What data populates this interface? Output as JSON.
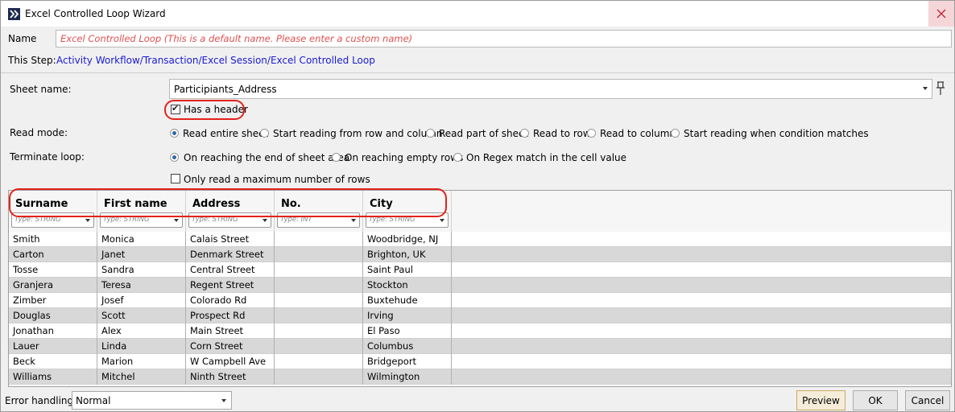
{
  "window": {
    "title": "Excel Controlled Loop Wizard"
  },
  "name_field": {
    "label": "Name",
    "placeholder": "Excel Controlled Loop  (This is a default name. Please enter a custom name)"
  },
  "step": {
    "label": "This Step:",
    "path": "Activity Workflow/Transaction/Excel Session/Excel Controlled Loop"
  },
  "sheet": {
    "label": "Sheet name:",
    "value": "Participiants_Address"
  },
  "has_header": {
    "label": "Has a header",
    "checked": true
  },
  "read_mode": {
    "label": "Read mode:",
    "options": [
      "Read entire sheet",
      "Start reading from row and column",
      "Read part of sheet",
      "Read to row",
      "Read to column",
      "Start reading when condition matches"
    ],
    "selected": "Read entire sheet"
  },
  "terminate_loop": {
    "label": "Terminate loop:",
    "options": [
      "On reaching the end of sheet area",
      "On reaching empty rows",
      "On Regex match in the cell value"
    ],
    "selected": "On reaching the end of sheet area"
  },
  "max_rows": {
    "label": "Only read a maximum number of rows",
    "checked": false
  },
  "grid": {
    "columns": [
      {
        "name": "Surname",
        "type": "Type: STRING"
      },
      {
        "name": "First name",
        "type": "Type: STRING"
      },
      {
        "name": "Address",
        "type": "Type: STRING"
      },
      {
        "name": "No.",
        "type": "Type: INT"
      },
      {
        "name": "City",
        "type": "Type: STRING"
      }
    ],
    "rows": [
      [
        "Smith",
        "Monica",
        "Calais Street",
        "",
        "Woodbridge, NJ"
      ],
      [
        "Carton",
        "Janet",
        "Denmark Street",
        "",
        "Brighton, UK"
      ],
      [
        "Tosse",
        "Sandra",
        "Central Street",
        "",
        "Saint Paul"
      ],
      [
        "Granjera",
        "Teresa",
        "Regent Street",
        "",
        "Stockton"
      ],
      [
        "Zimber",
        "Josef",
        "Colorado Rd",
        "",
        "Buxtehude"
      ],
      [
        "Douglas",
        "Scott",
        "Prospect Rd",
        "",
        "Irving"
      ],
      [
        "Jonathan",
        "Alex",
        "Main Street",
        "",
        "El Paso"
      ],
      [
        "Lauer",
        "Linda",
        "Corn Street",
        "",
        "Columbus"
      ],
      [
        "Beck",
        "Marion",
        "W Campbell Ave",
        "",
        "Bridgeport"
      ],
      [
        "Williams",
        "Mitchel",
        "Ninth Street",
        "",
        "Wilmington"
      ]
    ]
  },
  "error_handling": {
    "label": "Error handling:",
    "value": "Normal"
  },
  "buttons": {
    "preview": "Preview",
    "ok": "OK",
    "cancel": "Cancel"
  },
  "colors": {
    "highlight": "#e2231a",
    "link": "#1a1ad6",
    "placeholder": "#e05050",
    "alt_row": "#d8d8d8",
    "radio_selected": "#3467a8"
  }
}
